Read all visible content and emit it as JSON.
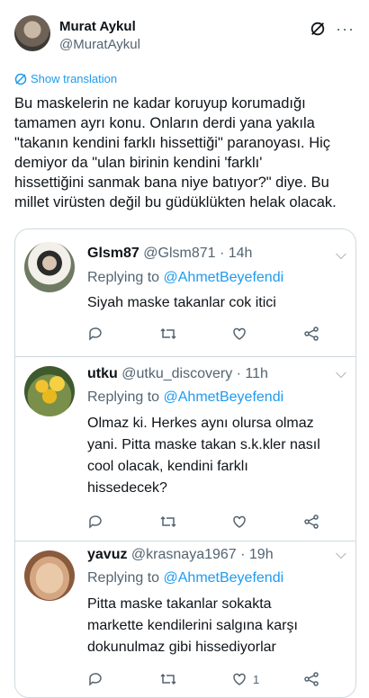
{
  "author": {
    "name": "Murat Aykul",
    "handle": "@MuratAykul"
  },
  "translate_label": "Show translation",
  "tweet_text": "Bu maskelerin ne kadar koruyup korumadığı\ntamamen ayrı konu. Onların derdi yana yakıla\n\"takanın kendini farklı hissettiği\" paranoyası. Hiç\ndemiyor da \"ulan birinin kendini 'farklı'\nhissettiğini sanmak bana niye batıyor?\" diye. Bu\nmillet virüsten değil bu güdüklükten helak olacak.",
  "replies": [
    {
      "name": "Glsm87",
      "handle": "@Glsm871",
      "time": "14h",
      "replying_label": "Replying to",
      "replying_to": "@AhmetBeyefendi",
      "text": "Siyah maske takanlar cok itici",
      "likes": ""
    },
    {
      "name": "utku",
      "handle": "@utku_discovery",
      "time": "11h",
      "replying_label": "Replying to",
      "replying_to": "@AhmetBeyefendi",
      "text": "Olmaz ki. Herkes aynı olursa olmaz\nyani. Pitta maske takan s.k.kler nasıl\ncool olacak, kendini farklı\nhissedecek?",
      "likes": ""
    },
    {
      "name": "yavuz",
      "handle": "@krasnaya1967",
      "time": "19h",
      "replying_label": "Replying to",
      "replying_to": "@AhmetBeyefendi",
      "text": "Pitta maske takanlar sokakta\nmarkette kendilerini salgına karşı\ndokunulmaz gibi hissediyorlar",
      "likes": "1"
    }
  ]
}
